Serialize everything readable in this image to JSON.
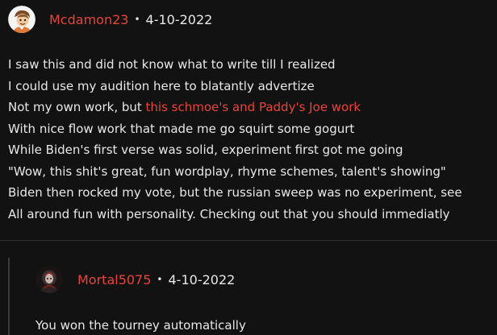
{
  "comment": {
    "username": "Mcdamon23",
    "separator": "•",
    "date": "4-10-2022",
    "lines": [
      "I saw this and did not know what to write till I realized",
      "I could use my audition here to blatantly advertize",
      "Not my own work, but ",
      "With nice flow work that made me go squirt some gogurt",
      "While Biden's first verse was solid, experiment first got me going",
      "\"Wow, this shit's great, fun wordplay, rhyme schemes, talent's showing\"",
      "Biden then rocked my vote, but the russian sweep was no experiment, see",
      "All around fun with personality. Checking out that you should immediatly"
    ],
    "link_text": "this schmoe's and Paddy's Joe work"
  },
  "reply": {
    "username": "Mortal5075",
    "separator": "•",
    "date": "4-10-2022",
    "text": "You won the tourney automatically"
  },
  "colors": {
    "background": "#121212",
    "text": "#e8e8e8",
    "accent": "#e8443a"
  },
  "icons": {
    "comment_avatar": "user-avatar-cartoon",
    "reply_avatar": "user-avatar-dark"
  }
}
